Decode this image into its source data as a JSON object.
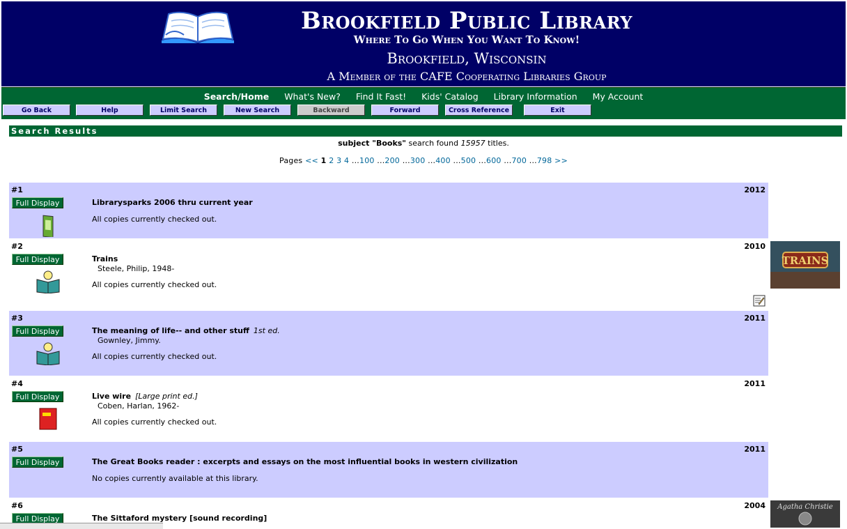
{
  "header": {
    "library_name": "Brookfield Public Library",
    "tagline": "Where To Go When You Want To Know!",
    "location": "Brookfield, Wisconsin",
    "member": "A Member of the CAFE Cooperating Libraries Group"
  },
  "nav": {
    "links": [
      "Search/Home",
      "What's New?",
      "Find It Fast!",
      "Kids' Catalog",
      "Library Information",
      "My Account"
    ],
    "buttons": [
      "Go Back",
      "Help",
      "Limit Search",
      "New Search",
      "Backward",
      "Forward",
      "Cross Reference",
      "Exit"
    ]
  },
  "results": {
    "heading": "Search Results",
    "summary_subject": "subject \"Books\"",
    "summary_mid": "search found",
    "summary_count": "15957",
    "summary_end": "titles.",
    "pages_label": "Pages",
    "pages_prev": "<<",
    "pages_current": "1",
    "pages_near": [
      "2",
      "3",
      "4"
    ],
    "pages_jumps": [
      "100",
      "200",
      "300",
      "400",
      "500",
      "600",
      "700",
      "798"
    ],
    "pages_next": ">>",
    "full_display_label": "Full Display"
  },
  "records": [
    {
      "num": "#1",
      "year": "2012",
      "title": "Librarysparks 2006 thru current year",
      "edition": "",
      "author": "",
      "availability": "All copies currently checked out.",
      "format": "magazine"
    },
    {
      "num": "#2",
      "year": "2010",
      "title": "Trains",
      "edition": "",
      "author": "Steele, Philip, 1948-",
      "availability": "All copies currently checked out.",
      "format": "juvenile-book"
    },
    {
      "num": "#3",
      "year": "2011",
      "title": "The meaning of life-- and other stuff",
      "edition": "1st ed.",
      "author": "Gownley, Jimmy.",
      "availability": "All copies currently checked out.",
      "format": "juvenile-book"
    },
    {
      "num": "#4",
      "year": "2011",
      "title": "Live wire",
      "edition": "[Large print ed.]",
      "author": "Coben, Harlan, 1962-",
      "availability": "All copies currently checked out.",
      "format": "large-print-book"
    },
    {
      "num": "#5",
      "year": "2011",
      "title": "The Great Books reader : excerpts and essays on the most influential books in western civilization",
      "edition": "",
      "author": "",
      "availability": "No copies currently available at this library.",
      "format": "none"
    },
    {
      "num": "#6",
      "year": "2004",
      "title": "The Sittaford mystery [sound recording]",
      "edition": "",
      "author": "",
      "availability": "",
      "format": "audio"
    }
  ],
  "covers": {
    "trains_text": "TRAINS",
    "sittaford_text": "Agatha Christie"
  },
  "colors": {
    "header_bg": "#000066",
    "nav_bg": "#006633",
    "row_shade": "#ccccff",
    "button_bg": "#ccccff",
    "link": "#006699"
  }
}
